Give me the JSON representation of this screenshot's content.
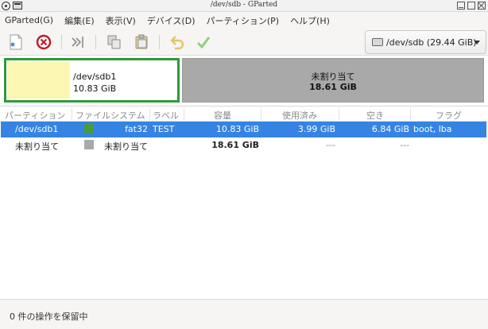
{
  "window": {
    "title": "/dev/sdb - GParted"
  },
  "menu": [
    {
      "label": "GParted(G)"
    },
    {
      "label": "編集(E)"
    },
    {
      "label": "表示(V)"
    },
    {
      "label": "デバイス(D)"
    },
    {
      "label": "パーティション(P)"
    },
    {
      "label": "ヘルプ(H)"
    }
  ],
  "toolbar": {
    "icons": [
      "new-partition-icon",
      "delete-partition-icon",
      "resize-move-icon",
      "copy-icon",
      "paste-icon",
      "undo-icon",
      "apply-icon"
    ],
    "device_selector": "/dev/sdb (29.44 GiB)"
  },
  "graph": {
    "partition": {
      "name": "/dev/sdb1",
      "size": "10.83 GiB",
      "border_color": "#2e9a3a",
      "used_color": "#fbf7b2"
    },
    "unallocated": {
      "name": "未割り当て",
      "size": "18.61 GiB",
      "color": "#a9a9a9"
    }
  },
  "table": {
    "columns": [
      "パーティション",
      "ファイルシステム",
      "ラベル",
      "容量",
      "使用済み",
      "空き",
      "フラグ"
    ],
    "rows": [
      {
        "partition": "/dev/sdb1",
        "fs_color": "#4a9a3e",
        "filesystem": "fat32",
        "label": "TEST",
        "size": "10.83 GiB",
        "used": "3.99 GiB",
        "free": "6.84 GiB",
        "flags": "boot, lba",
        "selected": true
      },
      {
        "partition": "未割り当て",
        "fs_color": "#a9a9a9",
        "filesystem": "未割り当て",
        "label": "",
        "size": "18.61 GiB",
        "used": "---",
        "free": "---",
        "flags": "",
        "selected": false
      }
    ]
  },
  "status": {
    "text": "0 件の操作を保留中"
  },
  "colors": {
    "selection": "#3584e4"
  }
}
